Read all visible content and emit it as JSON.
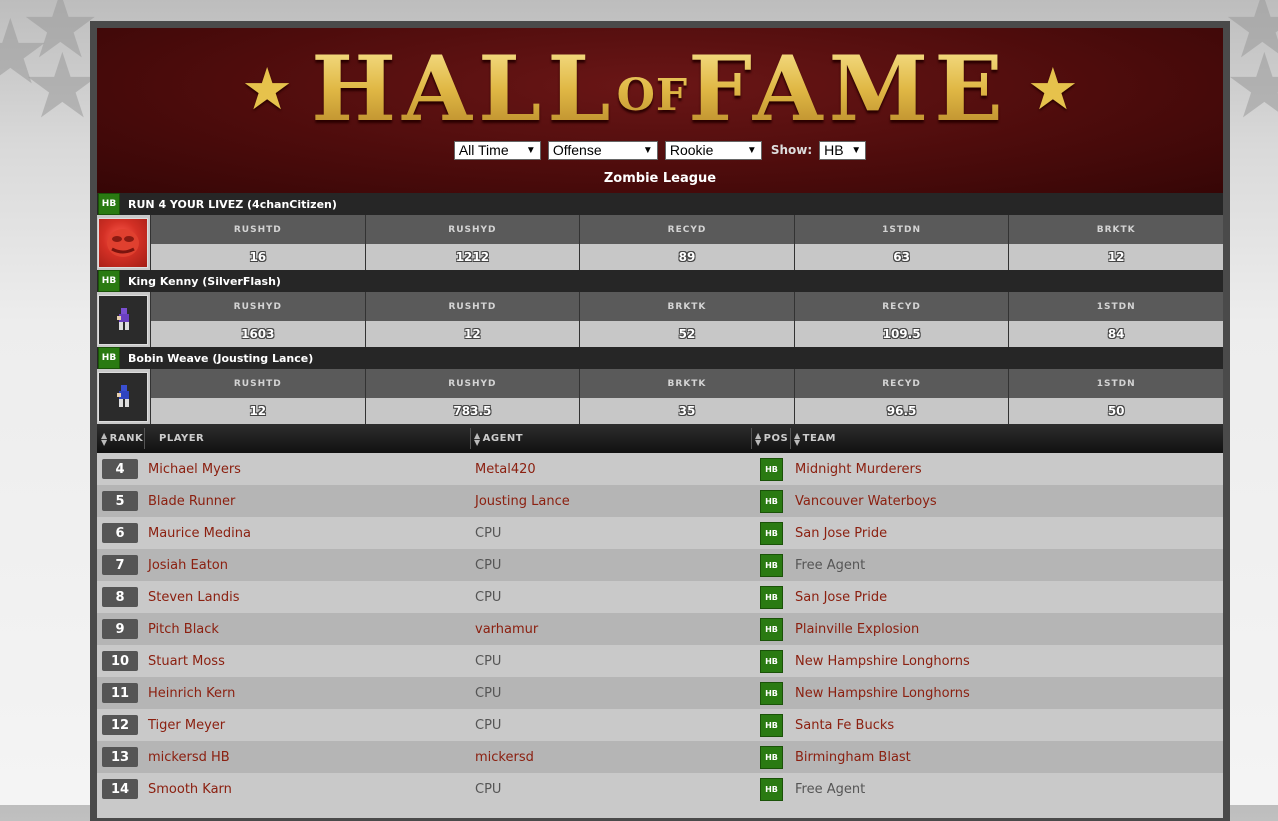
{
  "header": {
    "title_left": "HALL",
    "title_of": "OF",
    "title_right": "FAME",
    "league": "Zombie League",
    "filters": {
      "period": "All Time",
      "category": "Offense",
      "type": "Rookie",
      "show_label": "Show:",
      "show": "HB"
    }
  },
  "top_players": [
    {
      "pos": "HB",
      "name": "RUN 4 YOUR LIVEZ (4chanCitizen)",
      "avatar": "red-pepe-avatar",
      "stats": [
        {
          "label": "RUSHTD",
          "value": "16"
        },
        {
          "label": "RUSHYD",
          "value": "1212"
        },
        {
          "label": "RECYD",
          "value": "89"
        },
        {
          "label": "1STDN",
          "value": "63"
        },
        {
          "label": "BRKTK",
          "value": "12"
        }
      ]
    },
    {
      "pos": "HB",
      "name": "King Kenny (SilverFlash)",
      "avatar": "pixel-player-purple",
      "stats": [
        {
          "label": "RUSHYD",
          "value": "1603"
        },
        {
          "label": "RUSHTD",
          "value": "12"
        },
        {
          "label": "BRKTK",
          "value": "52"
        },
        {
          "label": "RECYD",
          "value": "109.5"
        },
        {
          "label": "1STDN",
          "value": "84"
        }
      ]
    },
    {
      "pos": "HB",
      "name": "Bobin Weave (Jousting Lance)",
      "avatar": "pixel-player-blue",
      "stats": [
        {
          "label": "RUSHTD",
          "value": "12"
        },
        {
          "label": "RUSHYD",
          "value": "783.5"
        },
        {
          "label": "BRKTK",
          "value": "35"
        },
        {
          "label": "RECYD",
          "value": "96.5"
        },
        {
          "label": "1STDN",
          "value": "50"
        }
      ]
    }
  ],
  "table": {
    "columns": [
      "RANK",
      "PLAYER",
      "AGENT",
      "POS",
      "TEAM"
    ],
    "rows": [
      {
        "rank": "4",
        "player": "Michael Myers",
        "agent": "Metal420",
        "agent_link": true,
        "pos": "HB",
        "team": "Midnight Murderers",
        "team_link": true
      },
      {
        "rank": "5",
        "player": "Blade Runner",
        "agent": "Jousting Lance",
        "agent_link": true,
        "pos": "HB",
        "team": "Vancouver Waterboys",
        "team_link": true
      },
      {
        "rank": "6",
        "player": "Maurice Medina",
        "agent": "CPU",
        "agent_link": false,
        "pos": "HB",
        "team": "San Jose Pride",
        "team_link": true
      },
      {
        "rank": "7",
        "player": "Josiah Eaton",
        "agent": "CPU",
        "agent_link": false,
        "pos": "HB",
        "team": "Free Agent",
        "team_link": false
      },
      {
        "rank": "8",
        "player": "Steven Landis",
        "agent": "CPU",
        "agent_link": false,
        "pos": "HB",
        "team": "San Jose Pride",
        "team_link": true
      },
      {
        "rank": "9",
        "player": "Pitch Black",
        "agent": "varhamur",
        "agent_link": true,
        "pos": "HB",
        "team": "Plainville Explosion",
        "team_link": true
      },
      {
        "rank": "10",
        "player": "Stuart Moss",
        "agent": "CPU",
        "agent_link": false,
        "pos": "HB",
        "team": "New Hampshire Longhorns",
        "team_link": true
      },
      {
        "rank": "11",
        "player": "Heinrich Kern",
        "agent": "CPU",
        "agent_link": false,
        "pos": "HB",
        "team": "New Hampshire Longhorns",
        "team_link": true
      },
      {
        "rank": "12",
        "player": "Tiger Meyer",
        "agent": "CPU",
        "agent_link": false,
        "pos": "HB",
        "team": "Santa Fe Bucks",
        "team_link": true
      },
      {
        "rank": "13",
        "player": "mickersd HB",
        "agent": "mickersd",
        "agent_link": true,
        "pos": "HB",
        "team": "Birmingham Blast",
        "team_link": true
      },
      {
        "rank": "14",
        "player": "Smooth Karn",
        "agent": "CPU",
        "agent_link": false,
        "pos": "HB",
        "team": "Free Agent",
        "team_link": false
      }
    ]
  },
  "colors": {
    "header_red": "#4e0c0c",
    "gold": "#e0b845",
    "link": "#8b2010",
    "pos_green": "#2a7a12"
  }
}
